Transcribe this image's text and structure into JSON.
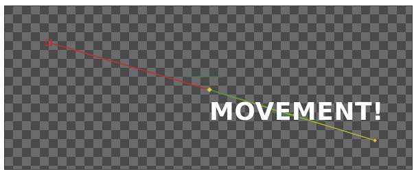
{
  "canvas": {
    "caption": "MOVEMENT!",
    "colors": {
      "checker_dark": "#4a4a4a",
      "checker_light": "#6b6b6b",
      "path_red": "#b9323a",
      "path_yellow": "#b8b83a",
      "path_green": "#3f8f3f",
      "caption_text": "#ffffff"
    },
    "icons": {
      "start_keyframe": "square-keyframe-icon",
      "mid_keyframe": "diamond-keyframe-icon",
      "end_keyframe": "diamond-keyframe-icon"
    }
  }
}
